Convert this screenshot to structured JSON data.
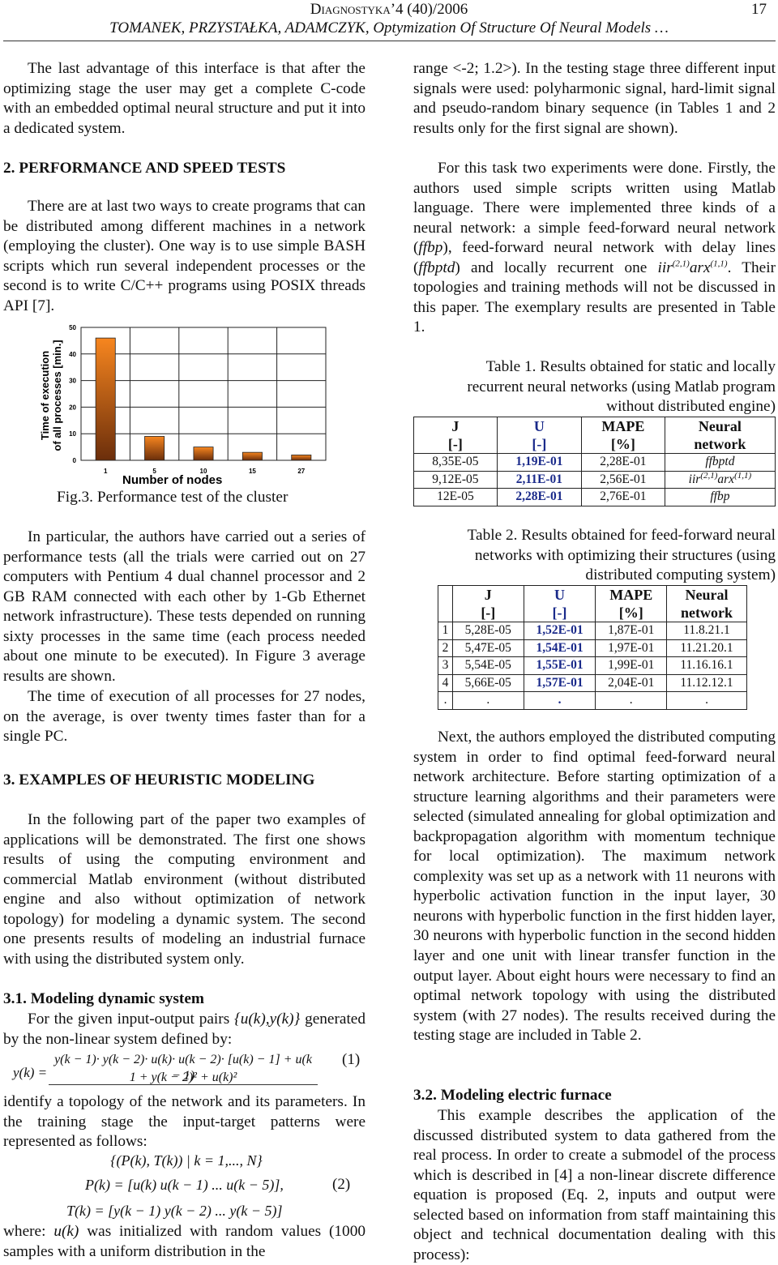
{
  "header": {
    "journal": "Diagnostyka’4 (40)/2006",
    "authors": "TOMANEK, PRZYSTAŁKA, ADAMCZYK, Optymization Of Structure Of Neural Models …",
    "page": "17"
  },
  "left": {
    "p1": "The last advantage of this interface is that after the optimizing stage the user may get a complete C-code with an embedded optimal neural structure and put it into a dedicated system.",
    "h2": "2. PERFORMANCE AND SPEED TESTS",
    "p2": "There are at last two ways to create programs that can be distributed among different machines in a network (employing the cluster). One way is to use simple BASH scripts which run several independent processes or the second is to write C/C++ programs using POSIX threads API [7].",
    "fig_caption": "Fig.3. Performance test of the cluster",
    "p3": "In particular, the authors have carried out a series of performance tests (all the trials were carried out on 27 computers with Pentium 4 dual channel processor and 2 GB RAM connected with each other by 1-Gb Ethernet network infrastructure). These tests depended on running sixty processes in the same time (each process needed about one minute to be executed). In Figure 3 average results are shown.",
    "p4": "The time of execution of all processes for 27 nodes, on the average, is over twenty times faster than for a single PC.",
    "h3": "3. EXAMPLES OF HEURISTIC MODELING",
    "p5": "In the following part of the paper two examples of applications will be demonstrated. The first one shows results of using the computing environment and commercial Matlab environment (without distributed engine and also without optimization of network topology) for modeling a dynamic system. The second one presents results of modeling an industrial furnace with using the distributed system only.",
    "h31": "3.1. Modeling dynamic system",
    "p6a": "For the given input-output pairs ",
    "p6b": "{u(k),y(k)}",
    "p6c": " generated by the non-linear system defined by:",
    "eq1_lhs": "y(k) =",
    "eq1_num": "y(k − 1)· y(k − 2)· u(k)· u(k − 2)· [u(k) − 1] + u(k − 1)",
    "eq1_den": "1 + y(k − 2)² + u(k)²",
    "eq1_no": "(1)",
    "p7": "identify a topology of the network and its parameters. In the training stage the input-target patterns were represented as follows:",
    "eq2_set": "{(P(k), T(k)) | k = 1,..., N}",
    "eq2_p": "P(k) = [u(k)   u(k − 1)   ...   u(k − 5)],",
    "eq2_t": "T(k) = [y(k − 1)   y(k − 2)   ...   y(k − 5)]",
    "eq2_no": "(2)",
    "p8a": "where: ",
    "p8b": "u(k)",
    "p8c": " was initialized with random values (1000 samples with a uniform distribution in the"
  },
  "right": {
    "p1": "range <-2; 1.2>). In the testing stage three different input signals were used: polyharmonic signal, hard-limit signal and pseudo-random binary sequence (in Tables 1 and 2 results only for the first signal are shown).",
    "p2a": "For this task two experiments were done. Firstly, the authors used simple scripts written using Matlab language. There were implemented three kinds of a neural network: a simple feed-forward neural network (",
    "p2b": "ffbp",
    "p2c": "), feed-forward neural network with delay lines (",
    "p2d": "ffbptd",
    "p2e": ") and locally recurrent one ",
    "p2f": "iir",
    "p2g": "(2,1)",
    "p2h": "arx",
    "p2i": "(1,1)",
    "p2j": ". Their topologies and training methods will not be discussed in this paper. The exemplary results are presented in Table 1.",
    "t1_caption": "Table 1. Results obtained for static and locally recurrent neural networks (using Matlab program without distributed engine)",
    "t2_caption": "Table 2. Results obtained for feed-forward neural networks with optimizing their structures (using distributed computing system)",
    "p3": "Next, the authors employed the distributed computing system in order to find optimal feed-forward neural network architecture. Before starting optimization of a structure learning algorithms and their parameters were selected (simulated annealing for global optimization and backpropagation algorithm with momentum technique for local optimization). The maximum network complexity was set up as a network with 11 neurons with hyperbolic activation function in the input layer, 30 neurons with hyperbolic function in the first hidden layer, 30 neurons with hyperbolic function in the second hidden layer and one unit with linear transfer function in the output layer. About eight hours were necessary to find an optimal network topology with using the distributed system (with 27 nodes). The results received during the testing stage are included in Table 2.",
    "h32": "3.2. Modeling electric furnace",
    "p4": "This example describes the application of the discussed distributed system to data gathered from the real process. In order to create a submodel of the process which is described in [4] a non-linear discrete difference equation is proposed (Eq. 2, inputs and output were selected based on information from staff maintaining this object and technical documentation dealing with this process):"
  },
  "table1": {
    "headers": [
      [
        "J",
        "[-]"
      ],
      [
        "U",
        "[-]"
      ],
      [
        "MAPE",
        "[%]"
      ],
      [
        "Neural",
        "network"
      ]
    ],
    "rows": [
      [
        "8,35E-05",
        "1,19E-01",
        "2,28E-01",
        "ffbptd"
      ],
      [
        "9,12E-05",
        "2,11E-01",
        "2,56E-01",
        "iir(2,1)arx(1,1)"
      ],
      [
        "12E-05",
        "2,28E-01",
        "2,76E-01",
        "ffbp"
      ]
    ]
  },
  "table2": {
    "headers": [
      [
        "",
        ""
      ],
      [
        "J",
        "[-]"
      ],
      [
        "U",
        "[-]"
      ],
      [
        "MAPE",
        "[%]"
      ],
      [
        "Neural",
        "network"
      ]
    ],
    "rows": [
      [
        "1",
        "5,28E-05",
        "1,52E-01",
        "1,87E-01",
        "11.8.21.1"
      ],
      [
        "2",
        "5,47E-05",
        "1,54E-01",
        "1,97E-01",
        "11.21.20.1"
      ],
      [
        "3",
        "5,54E-05",
        "1,55E-01",
        "1,99E-01",
        "11.16.16.1"
      ],
      [
        "4",
        "5,66E-05",
        "1,57E-01",
        "2,04E-01",
        "11.12.12.1"
      ],
      [
        ".",
        ".",
        ".",
        ".",
        "."
      ]
    ]
  },
  "chart_data": {
    "type": "bar",
    "categories": [
      "1",
      "5",
      "10",
      "15",
      "27"
    ],
    "values": [
      46,
      9,
      5,
      3,
      2
    ],
    "xlabel": "Number of nodes",
    "ylabel": "Time of execution of all processes [min.]",
    "ylim": [
      0,
      50
    ],
    "yticks": [
      0,
      10,
      20,
      30,
      40,
      50
    ],
    "grid": true,
    "bar_color": "#e8731a"
  }
}
